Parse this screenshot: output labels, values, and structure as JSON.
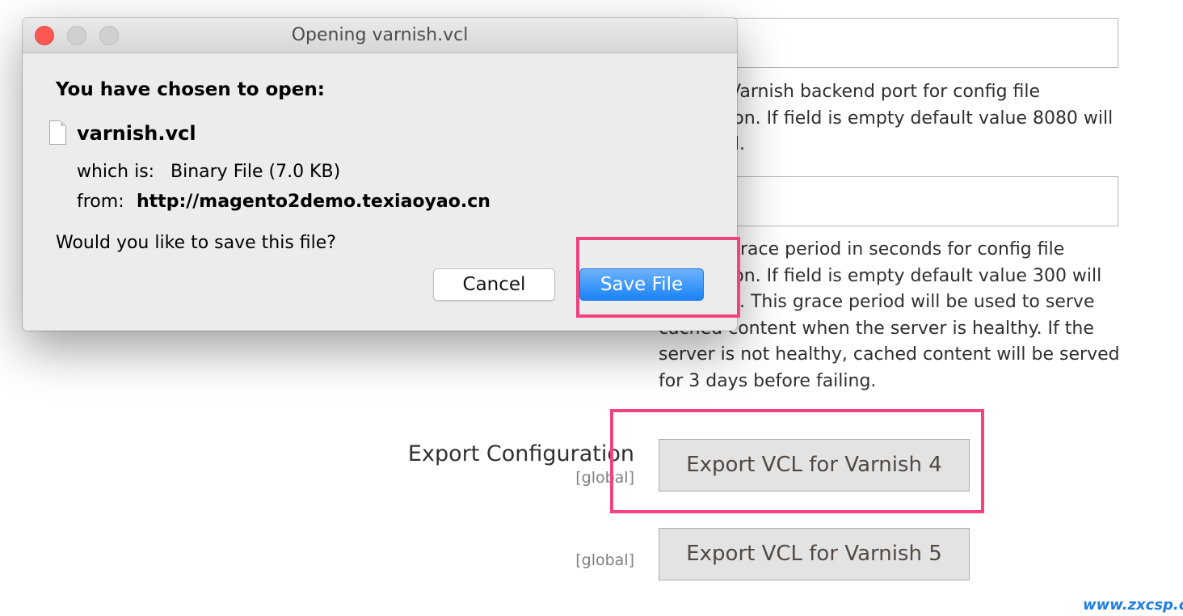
{
  "background": {
    "backend_port_note": "Specify Varnish backend port for config file generation. If field is empty default value 8080 will be saved.",
    "grace_period_note": "Specify grace period in seconds for config file generation. If field is empty default value 300 will be saved. This grace period will be used to serve cached content when the server is healthy. If the server is not healthy, cached content will be served for 3 days before failing.",
    "export_label": "Export Configuration",
    "scope_1": "[global]",
    "scope_2": "[global]",
    "export_v4": "Export VCL for Varnish 4",
    "export_v5": "Export VCL for Varnish 5"
  },
  "dialog": {
    "title": "Opening varnish.vcl",
    "heading": "You have chosen to open:",
    "file_name": "varnish.vcl",
    "which_is_label": "which is:",
    "which_is_value": "Binary File (7.0 KB)",
    "from_label": "from:",
    "from_value": "http://magento2demo.texiaoyao.cn",
    "question": "Would you like to save this file?",
    "cancel_label": "Cancel",
    "save_label": "Save File"
  },
  "highlight_color": "#f0437f",
  "watermark": "www.zxcsp.cn"
}
